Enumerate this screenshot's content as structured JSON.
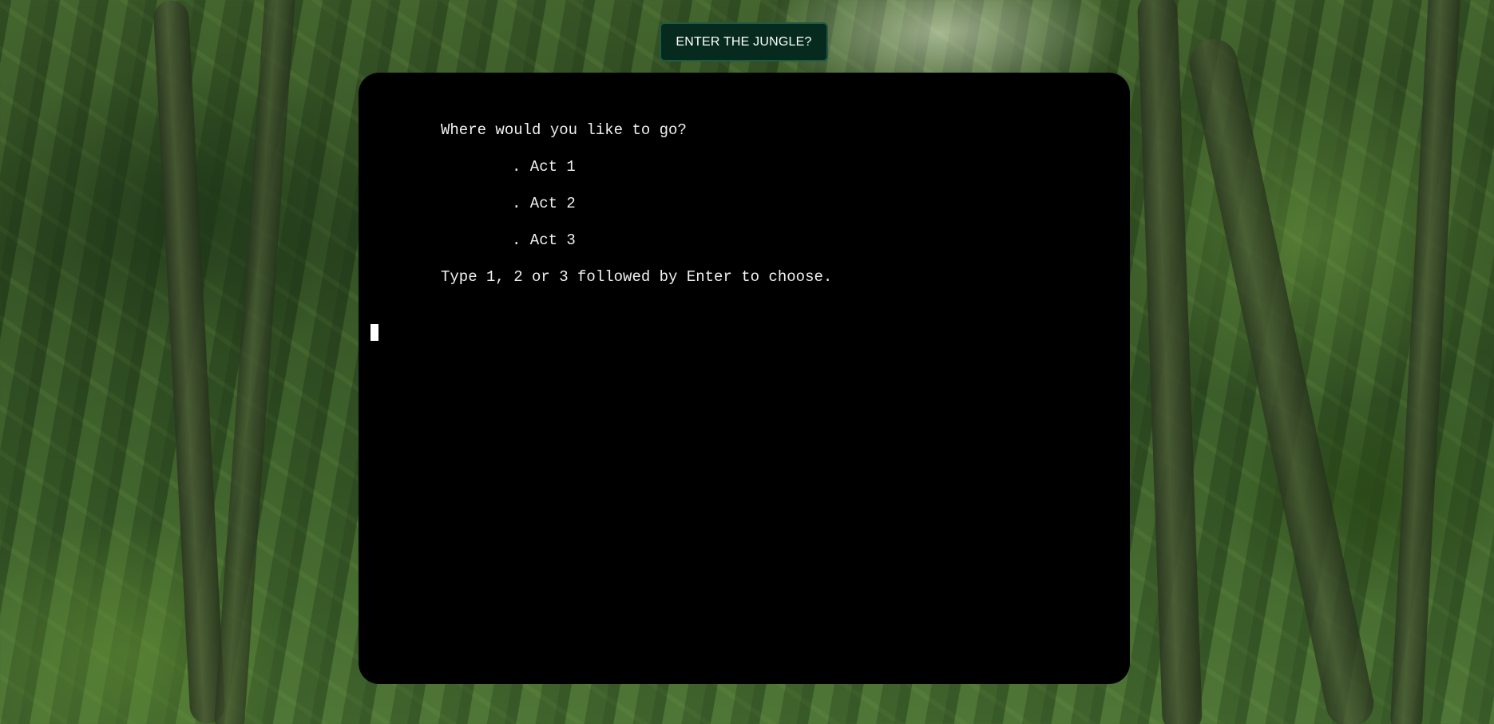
{
  "header": {
    "enter_button_label": "ENTER THE JUNGLE?"
  },
  "terminal": {
    "prompt": "Where would you like to go?",
    "options": [
      ". Act 1",
      ". Act 2",
      ". Act 3"
    ],
    "instruction": "Type 1, 2 or 3 followed by Enter to choose."
  },
  "colors": {
    "button_bg": "#062a1e",
    "button_border": "#1f5a44",
    "terminal_bg": "#000000",
    "terminal_text": "#f1f1f1"
  }
}
